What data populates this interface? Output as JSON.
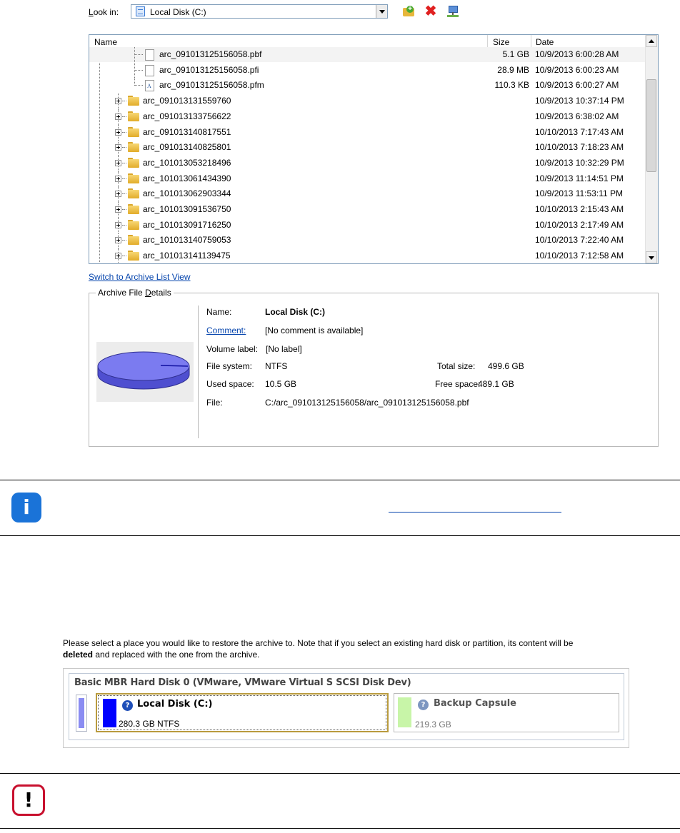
{
  "look_in": {
    "label": "Look in:",
    "value": "Local Disk (C:)",
    "icons": [
      "new-folder-icon",
      "delete-icon",
      "network-icon"
    ]
  },
  "tree": {
    "columns": {
      "name": "Name",
      "size": "Size",
      "date": "Date"
    },
    "files": [
      {
        "name": "arc_091013125156058.pbf",
        "size": "5.1 GB",
        "date": "10/9/2013 6:00:28 AM",
        "icon": "file-icon"
      },
      {
        "name": "arc_091013125156058.pfi",
        "size": "28.9 MB",
        "date": "10/9/2013 6:00:23 AM",
        "icon": "file-icon"
      },
      {
        "name": "arc_091013125156058.pfm",
        "size": "110.3 KB",
        "date": "10/9/2013 6:00:27 AM",
        "icon": "archive-file-icon"
      }
    ],
    "folders": [
      {
        "name": "arc_091013131559760",
        "date": "10/9/2013 10:37:14 PM"
      },
      {
        "name": "arc_091013133756622",
        "date": "10/9/2013 6:38:02 AM"
      },
      {
        "name": "arc_091013140817551",
        "date": "10/10/2013 7:17:43 AM"
      },
      {
        "name": "arc_091013140825801",
        "date": "10/10/2013 7:18:23 AM"
      },
      {
        "name": "arc_101013053218496",
        "date": "10/9/2013 10:32:29 PM"
      },
      {
        "name": "arc_101013061434390",
        "date": "10/9/2013 11:14:51 PM"
      },
      {
        "name": "arc_101013062903344",
        "date": "10/9/2013 11:53:11 PM"
      },
      {
        "name": "arc_101013091536750",
        "date": "10/10/2013 2:15:43 AM"
      },
      {
        "name": "arc_101013091716250",
        "date": "10/10/2013 2:17:49 AM"
      },
      {
        "name": "arc_101013140759053",
        "date": "10/10/2013 7:22:40 AM"
      },
      {
        "name": "arc_101013141139475",
        "date": "10/10/2013 7:12:58 AM"
      }
    ]
  },
  "switch_link": "Switch to Archive List View",
  "details": {
    "legend": "Archive File Details",
    "name_label": "Name:",
    "name_value": "Local Disk (C:)",
    "comment_label": "Comment:",
    "comment_value": "[No comment is available]",
    "volume_label": "Volume label:",
    "volume_value": "[No label]",
    "fs_label": "File system:",
    "fs_value": "NTFS",
    "total_label": "Total size:",
    "total_value": "499.6 GB",
    "used_label": "Used space:",
    "used_value": "10.5 GB",
    "free_label": "Free space:",
    "free_value": "489.1 GB",
    "file_label": "File:",
    "file_value": "C:/arc_091013125156058/arc_091013125156058.pbf"
  },
  "restore": {
    "text_line1": "Please select a place you would like to restore the archive to. Note that if you select an existing hard disk or partition, its content will be",
    "text_bold": "deleted",
    "text_line2_rest": " and replaced with the one from the archive.",
    "disk_title": "Basic MBR Hard Disk 0 (VMware, VMware Virtual S SCSI Disk Dev)",
    "partitions": [
      {
        "name": "Local Disk (C:)",
        "size": "280.3 GB",
        "fs": "NTFS",
        "color": "#0000ff"
      },
      {
        "name": "Backup Capsule",
        "size": "219.3 GB",
        "fs": "",
        "color": "#c8f5a8"
      }
    ]
  },
  "colors": {
    "link": "#0645ad",
    "info": "#1a73d8",
    "warning": "#c8102e"
  }
}
